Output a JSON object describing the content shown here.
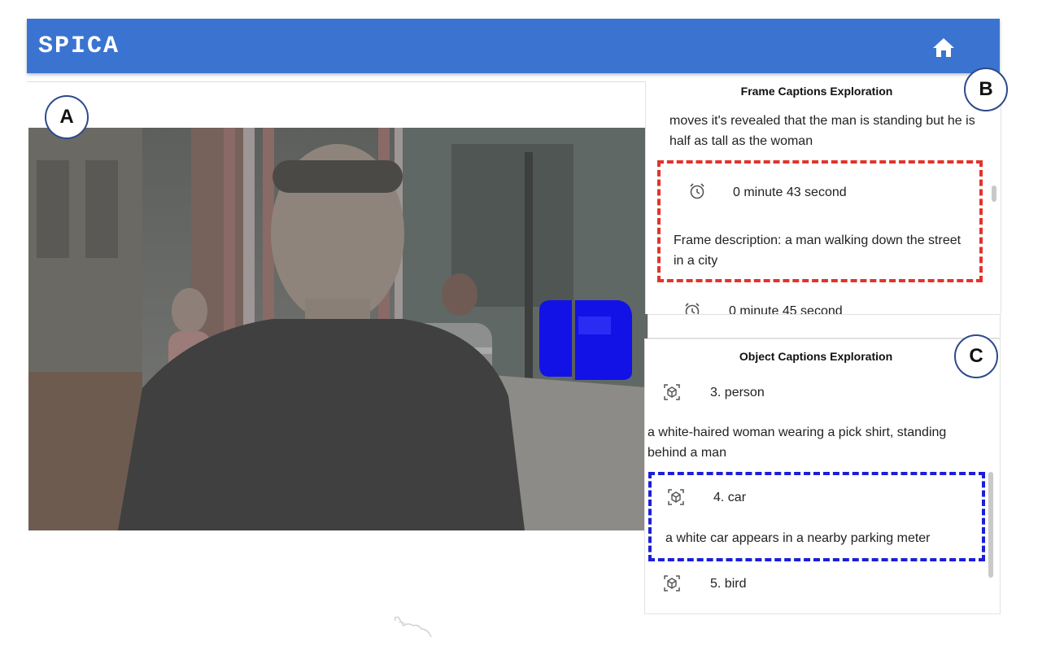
{
  "app": {
    "title": "SPICA",
    "accent_color": "#3a74d0",
    "home_icon": "home-icon"
  },
  "badges": {
    "a": "A",
    "b": "B",
    "c": "C"
  },
  "video": {
    "highlight_color": "#1212e6"
  },
  "frame_panel": {
    "title": "Frame Captions Exploration",
    "previous_fragment": "moves it's revealed that the man is standing but he is half as tall as the woman",
    "highlight_color": "#e3332b",
    "items": [
      {
        "icon": "alarm-clock-icon",
        "time": "0 minute 43 second",
        "description": "Frame description: a man walking down the street in a city"
      },
      {
        "icon": "alarm-clock-icon",
        "time": "0 minute 45 second"
      }
    ]
  },
  "object_panel": {
    "title": "Object Captions Exploration",
    "highlight_color": "#1c1fd6",
    "items": [
      {
        "icon": "cube-scan-icon",
        "label": "3. person",
        "description": "a white-haired woman wearing a pick shirt, standing behind a man"
      },
      {
        "icon": "cube-scan-icon",
        "label": "4. car",
        "description": "a white car appears in a nearby parking meter"
      },
      {
        "icon": "cube-scan-icon",
        "label": "5. bird"
      }
    ]
  }
}
